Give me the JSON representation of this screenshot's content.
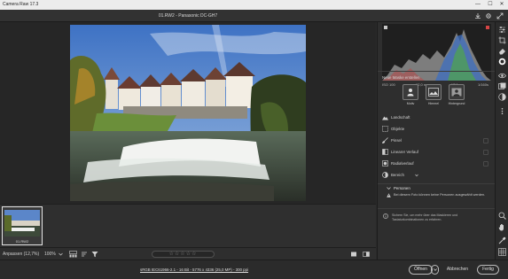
{
  "window": {
    "title": "Camera Raw 17.3",
    "controls": [
      "—",
      "☐",
      "✕"
    ]
  },
  "header": {
    "file_title": "01.RW2  -  Panasonic DC-GH7"
  },
  "filmstrip": {
    "thumb_name": "01.RW2"
  },
  "status": {
    "fit_label": "Anpassen (12,7%)",
    "zoom_value": "100%",
    "stars": "☆☆☆☆☆"
  },
  "bottom": {
    "file_info": "sRGB IEC61966-2.1 - 16 Bit - 5776 x 4336 (25,0 MP) - 300 ppi",
    "open_label": "Öffnen",
    "cancel_label": "Abbrechen",
    "done_label": "Fertig"
  },
  "histogram": {
    "iso": "ISO 100",
    "focal": "12,0 mm",
    "aperture": "f/7,1",
    "shutter": "1/160s"
  },
  "masking": {
    "create_title": "Neue Maske erstellen",
    "buttons": [
      {
        "label": "Motiv"
      },
      {
        "label": "Himmel"
      },
      {
        "label": "Hintergrund"
      }
    ],
    "items": [
      {
        "label": "Landschaft"
      },
      {
        "label": "Objekte"
      },
      {
        "label": "Pinsel"
      },
      {
        "label": "Linearer Verlauf"
      },
      {
        "label": "Radialverlauf"
      },
      {
        "label": "Bereich"
      }
    ],
    "persons_title": "Personen",
    "persons_msg": "Bei diesem Foto können keine Personen ausgewählt werden.",
    "hint": "Sichern Sie, um mehr über das Maskieren und Tastaturkombinationen zu erfahren."
  },
  "colors": {
    "accent": "#1473e6",
    "panel_bg": "#2e2e2e",
    "canvas_bg": "#262626"
  }
}
